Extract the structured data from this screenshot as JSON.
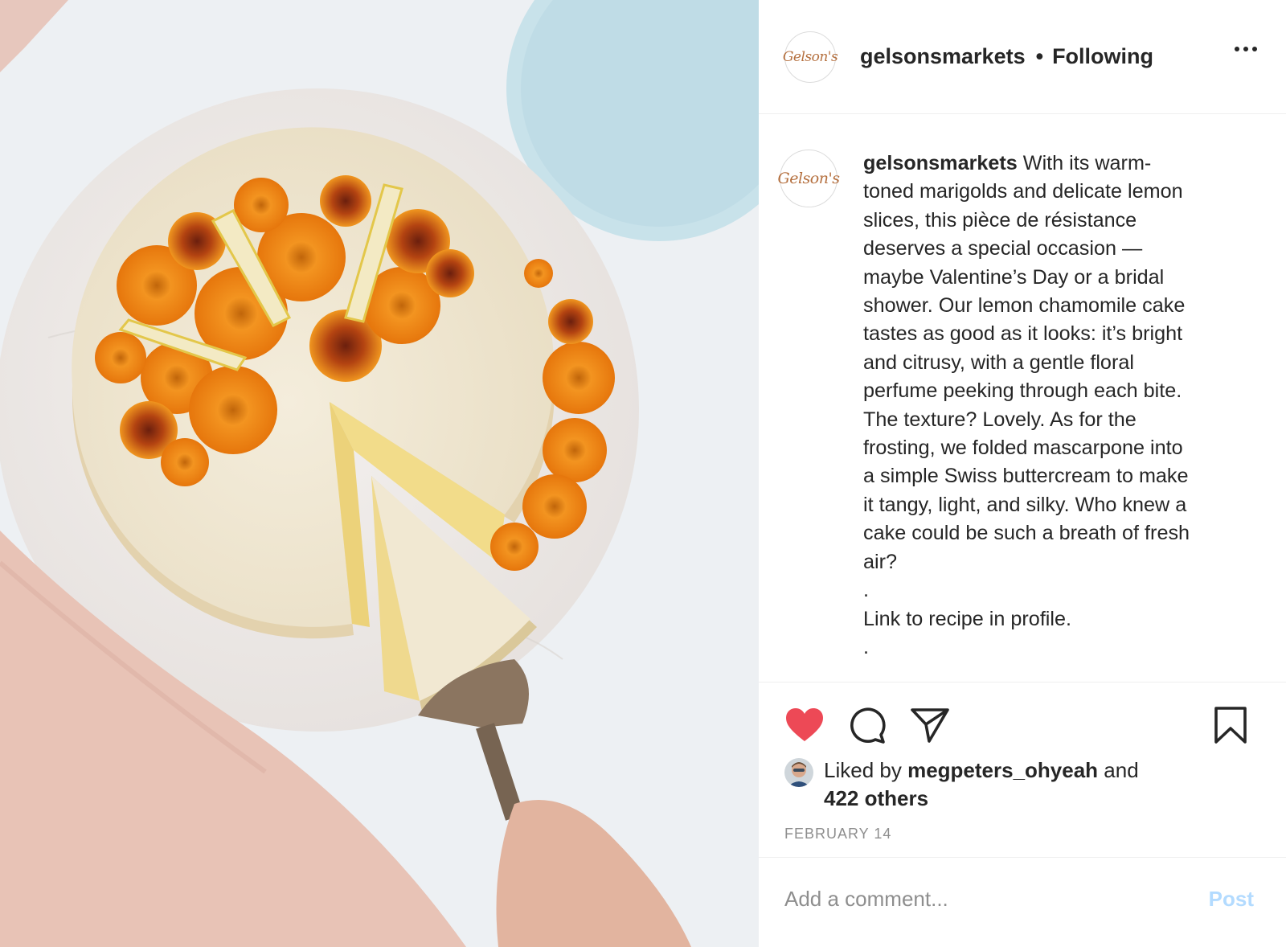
{
  "post": {
    "username": "gelsonsmarkets",
    "separator": "•",
    "follow_status": "Following",
    "avatar_logo_text": "Gelson's",
    "caption_username": "gelsonsmarkets",
    "caption_text": " With its warm-\ntoned marigolds and delicate lemon\nslices, this pièce de résistance\ndeserves a special occasion —\nmaybe Valentine’s Day or a bridal\nshower. Our lemon chamomile cake\ntastes as good as it looks: it’s bright\nand citrusy, with a gentle floral\nperfume peeking through each bite.\nThe texture? Lovely. As for the\nfrosting, we folded mascarpone into\na simple Swiss buttercream to make\nit tangy, light, and silky. Who knew a\ncake could be such a breath of fresh\nair?\n.\nLink to recipe in profile.\n.",
    "liked_by_prefix": "Liked by ",
    "liked_by_user": "megpeters_ohyeah",
    "liked_by_and": " and",
    "likes_others": "422 others",
    "date": "FEBRUARY 14",
    "comment_placeholder": "Add a comment...",
    "post_button": "Post"
  },
  "icons": {
    "like": "heart-filled-icon",
    "comment": "comment-bubble-icon",
    "share": "paper-plane-icon",
    "save": "bookmark-icon",
    "more": "ellipsis-icon"
  },
  "colors": {
    "like_red": "#ed4956",
    "post_button_disabled": "#b3dbff",
    "secondary_text": "#8e8e8e",
    "divider": "#efefef"
  }
}
